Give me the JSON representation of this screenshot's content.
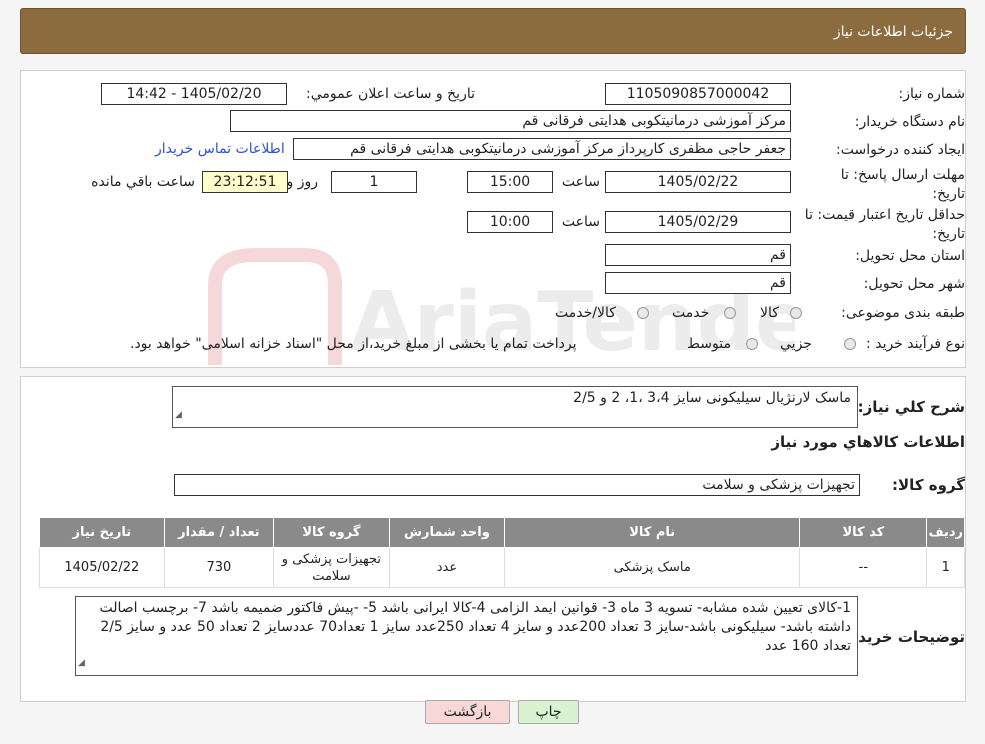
{
  "header": {
    "title": "جزئیات اطلاعات نیاز"
  },
  "form": {
    "need_number_label": "شماره نیاز:",
    "need_number": "1105090857000042",
    "announce_label": "تاریخ و ساعت اعلان عمومي:",
    "announce_value": "1405/02/20 - 14:42",
    "buyer_org_label": "نام دستگاه خریدار:",
    "buyer_org": "مرکز آموزشی درمانیتکوبی هدایتی فرقانی قم",
    "requester_label": "ایجاد کننده درخواست:",
    "requester": "جعفر حاجی مظفری کارپرداز مرکز آموزشی درمانیتکوبی هدایتی فرقانی قم",
    "contact_link": "اطلاعات تماس خریدار",
    "deadline_label_1": "مهلت ارسال پاسخ: تا",
    "deadline_label_2": "تاریخ:",
    "deadline_date": "1405/02/22",
    "time_word": "ساعت",
    "deadline_time": "15:00",
    "days": "1",
    "day_and": "روز و",
    "remaining_time": "23:12:51",
    "remaining_label": "ساعت باقي مانده",
    "validity_label_1": "حداقل تاریخ اعتبار قیمت: تا",
    "validity_label_2": "تاریخ:",
    "validity_date": "1405/02/29",
    "validity_time": "10:00",
    "province_label": "استان محل تحویل:",
    "province": "قم",
    "city_label": "شهر محل تحویل:",
    "city": "قم",
    "category_label": "طبقه بندی موضوعی:",
    "category_options": [
      "کالا",
      "خدمت",
      "کالا/خدمت"
    ],
    "process_label": "نوع فرآیند خرید :",
    "process_options": [
      "جزیي",
      "متوسط"
    ],
    "process_note": "پرداخت تمام یا بخشی از مبلغ خرید،از محل \"اسناد خزانه اسلامی\" خواهد بود."
  },
  "summary": {
    "label": "شرح کلي نیاز:",
    "value": "ماسک لارنژیال سیلیکونی سایز 3،4 ،1، 2 و 2/5"
  },
  "goods": {
    "title": "اطلاعات کالاهاي مورد نیاز",
    "group_label": "گروه کالا:",
    "group_value": "تجهیزات پزشکی و سلامت",
    "columns": [
      "ردیف",
      "کد کالا",
      "نام کالا",
      "واحد شمارش",
      "گروه کالا",
      "تعداد / مقدار",
      "تاریخ نیاز"
    ],
    "rows": [
      [
        "1",
        "--",
        "ماسک پزشکی",
        "عدد",
        "تجهیزات پزشکی و سلامت",
        "730",
        "1405/02/22"
      ]
    ]
  },
  "buyer_notes": {
    "label": "توضیحات خریدار:",
    "value": "1-کالای تعیین شده مشابه- تسویه 3 ماه 3- قوانین ایمد الزامی 4-کالا ایرانی باشد 5- -پیش فاکتور ضمیمه باشد 7- برچسب اصالت داشته باشد- سیلیکونی باشد-سایز 3 تعداد 200عدد و سایز 4 تعداد 250عدد سایز 1 تعداد70 عددسایز 2 تعداد 50 عدد و سایز 2/5 تعداد 160 عدد"
  },
  "buttons": {
    "print": "چاپ",
    "back": "بازگشت"
  },
  "watermark": {
    "text": "AriaTender.neT"
  },
  "colors": {
    "header": "#8c6b3f",
    "table_header": "#8a8a8a",
    "link": "#2a54d1",
    "back_button": "#f8d7d7",
    "print_button": "#d9f2d0"
  }
}
